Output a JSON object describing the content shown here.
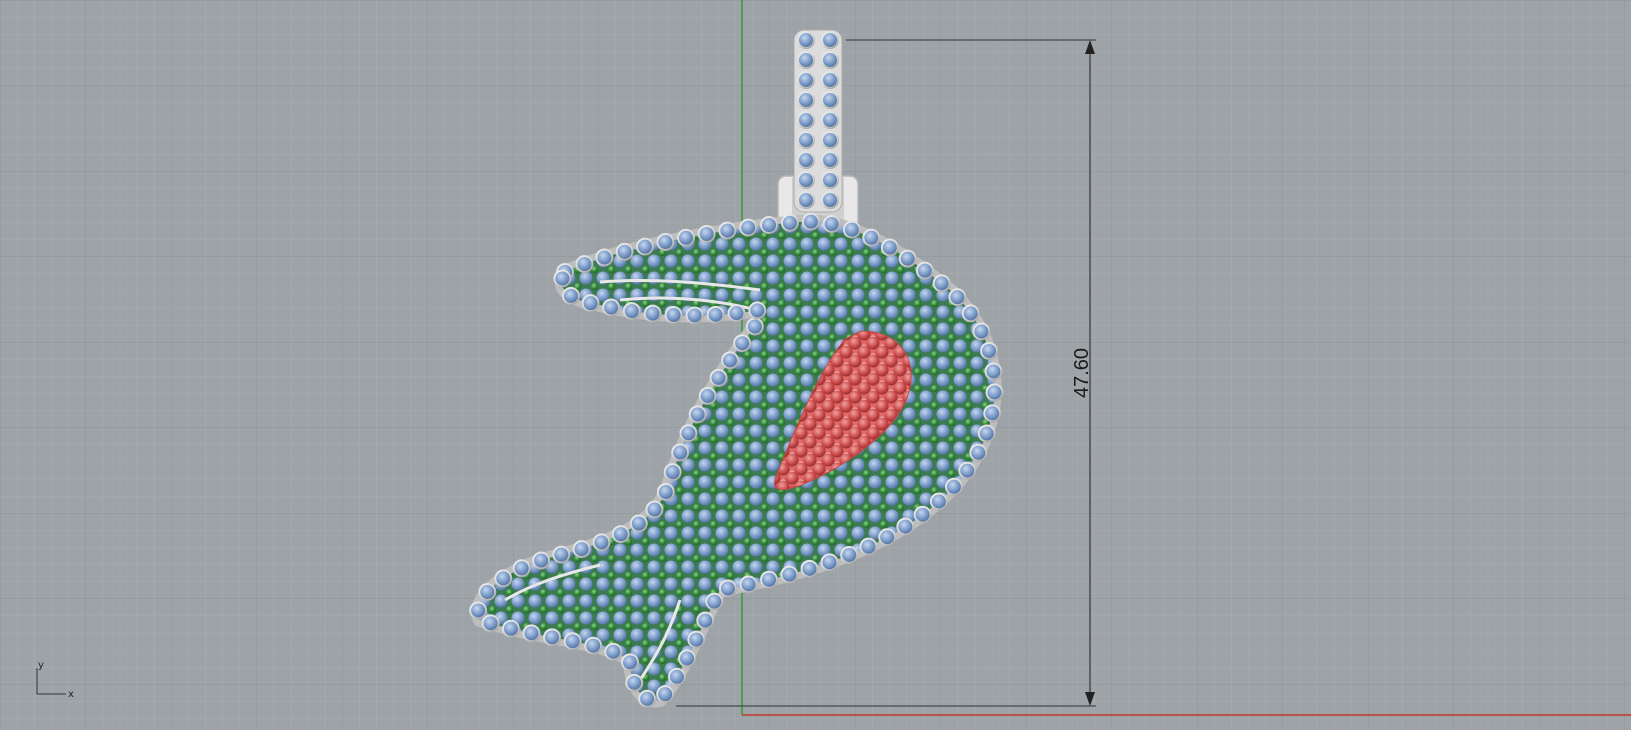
{
  "viewport": {
    "name": "Top",
    "background": "#9ea3a8",
    "grid_minor_color": "#a6abb0",
    "grid_major_color": "#8c9196",
    "x_axis_color": "#c0392b",
    "y_axis_color": "#2e9a3a"
  },
  "dimension": {
    "value": "47.60"
  },
  "axis_icon": {
    "x_label": "x",
    "y_label": "y"
  },
  "gem_colors": {
    "main_stone": "#7f9fcc",
    "pave_stone": "#3f8d3f",
    "accent_stone": "#cc4b4b",
    "metal": "#e2e2e2"
  },
  "icons": [
    "dimension-arrow-icon",
    "axis-widget-icon"
  ]
}
